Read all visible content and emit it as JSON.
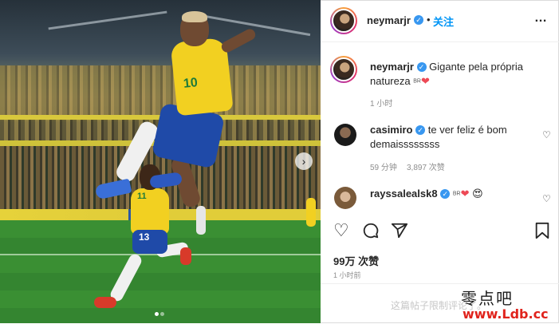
{
  "post": {
    "author": "neymarjr",
    "follow_label": "关注",
    "separator": "•",
    "more_icon": "…",
    "caption_user": "neymarjr",
    "caption_text": "Gigante pela própria natureza",
    "caption_flag": "BR",
    "caption_emoji": "❤",
    "caption_time": "1 小时",
    "likes": "99万 次赞",
    "post_time": "1 小时前",
    "comments_disabled": "这篇帖子限制评论了。",
    "jersey_number_main": "10",
    "jersey_number_2": "11",
    "shorts_number_2": "13"
  },
  "comments": [
    {
      "user": "casimiro",
      "text": "te ver feliz é bom demaissssssss",
      "time": "59 分钟",
      "likes": "3,897 次赞"
    },
    {
      "user": "rayssalealsk8",
      "flag": "BR",
      "emoji1": "❤",
      "emoji2": "😍"
    }
  ],
  "icons": {
    "like": "heart-outline-icon",
    "comment": "comment-bubble-icon",
    "share": "paper-plane-icon",
    "save": "bookmark-icon",
    "next": "chevron-right-icon",
    "verified": "verified-badge-icon"
  },
  "watermark": {
    "line1": "零点吧",
    "line2": "www.Ldb.cc"
  },
  "colors": {
    "follow": "#0095f6",
    "verified": "#3897f0",
    "heart": "#ed4956",
    "meta": "#8e8e8e"
  },
  "carousel": {
    "current": 1,
    "total": 2
  }
}
